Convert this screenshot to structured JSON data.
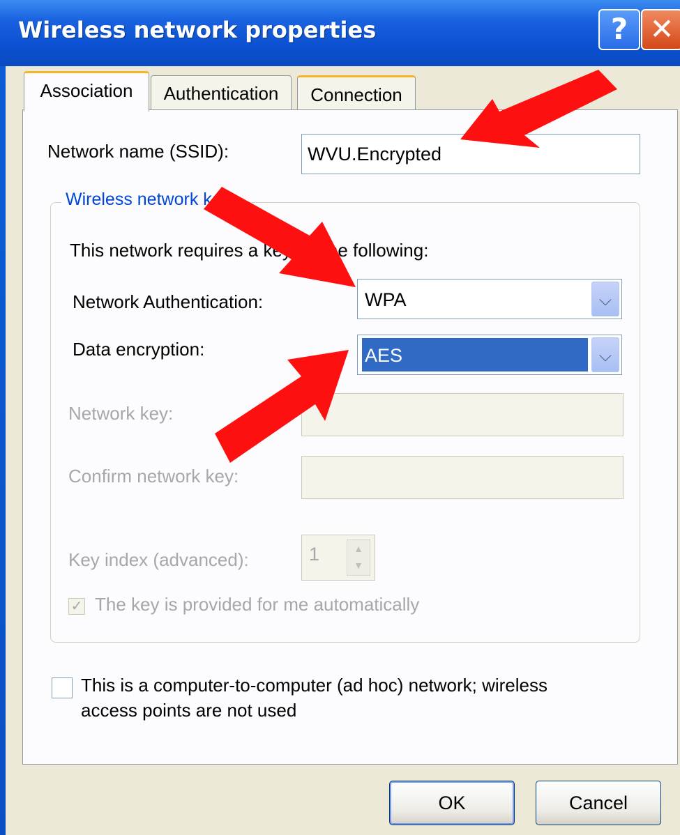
{
  "window": {
    "title": "Wireless network properties",
    "help_glyph": "?",
    "close_glyph": "✕"
  },
  "tabs": [
    {
      "label": "Association",
      "active": true
    },
    {
      "label": "Authentication",
      "active": false
    },
    {
      "label": "Connection",
      "active": false
    }
  ],
  "ssid": {
    "label": "Network name (SSID):",
    "value": "WVU.Encrypted"
  },
  "wireless_key": {
    "group_title": "Wireless network key",
    "intro": "This network requires a key for the following:",
    "auth_label": "Network Authentication:",
    "auth_value": "WPA",
    "enc_label": "Data encryption:",
    "enc_value": "AES",
    "netkey_label": "Network key:",
    "confirm_label": "Confirm network key:",
    "index_label": "Key index (advanced):",
    "index_value": "1",
    "auto_label": "The key is provided for me automatically"
  },
  "adhoc": {
    "label_line1": "This is a computer-to-computer (ad hoc) network; wireless",
    "label_line2": "access points are not used"
  },
  "buttons": {
    "ok": "OK",
    "cancel": "Cancel"
  },
  "icons": {
    "dropdown": "chevron-down-icon",
    "check": "checkmark-icon",
    "annotation": "red-arrow"
  },
  "colors": {
    "title_bar": "#0a50d0",
    "selection": "#316ac5",
    "annotation_arrow": "#ff0000",
    "tab_hot": "#f5b526"
  }
}
